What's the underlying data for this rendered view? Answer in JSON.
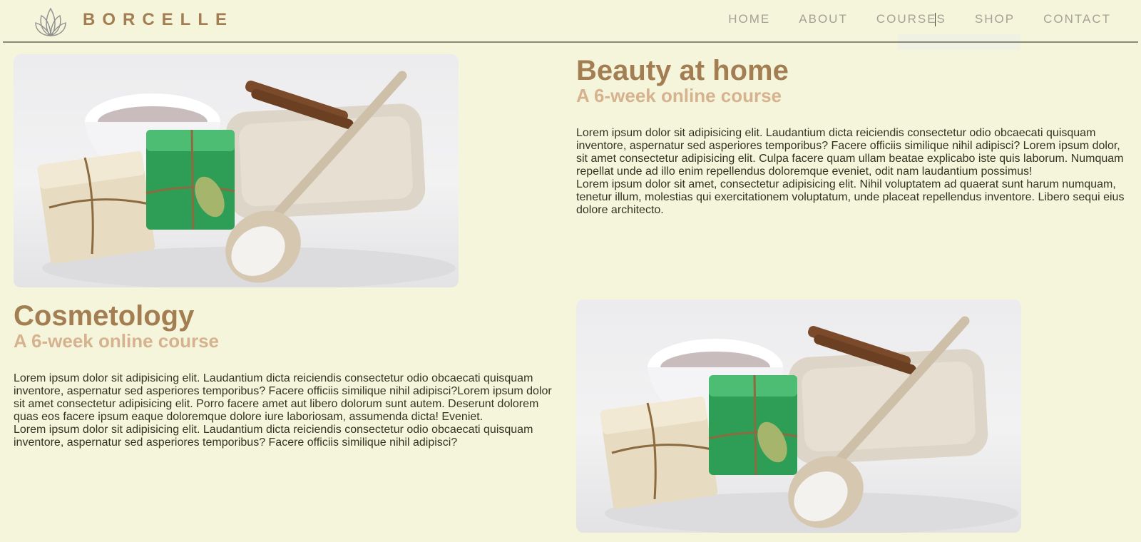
{
  "header": {
    "brand": "BORCELLE",
    "logo_icon": "lotus-icon",
    "nav": [
      {
        "label": "HOME"
      },
      {
        "label": "ABOUT"
      },
      {
        "label": "COURSES"
      },
      {
        "label": "SHOP"
      },
      {
        "label": "CONTACT"
      }
    ]
  },
  "sections": [
    {
      "title": "Beauty at home",
      "subtitle": "A 6-week online course",
      "paragraphs": [
        "Lorem ipsum dolor sit adipisicing elit. Laudantium dicta reiciendis consectetur odio obcaecati quisquam inventore, aspernatur sed asperiores temporibus? Facere officiis similique nihil adipisci? Lorem ipsum dolor, sit amet consectetur adipisicing elit. Culpa facere quam ullam beatae explicabo iste quis laborum. Numquam repellat unde ad illo enim repellendus doloremque eveniet, odit nam laudantium possimus!",
        "Lorem ipsum dolor sit amet, consectetur adipisicing elit. Nihil voluptatem ad quaerat sunt harum numquam, tenetur illum, molestias qui exercitationem voluptatum, unde placeat repellendus inventore. Libero sequi eius dolore architecto."
      ]
    },
    {
      "title": "Cosmetology",
      "subtitle": "A 6-week online course",
      "paragraphs": [
        "Lorem ipsum dolor sit adipisicing elit. Laudantium dicta reiciendis consectetur odio obcaecati quisquam inventore, aspernatur sed asperiores temporibus? Facere officiis similique nihil adipisci?Lorem ipsum dolor sit amet consectetur adipisicing elit. Porro facere amet aut libero dolorum sunt autem. Deserunt dolorem quas eos facere ipsum eaque doloremque dolore iure laboriosam, assumenda dicta! Eveniet.",
        "Lorem ipsum dolor sit adipisicing elit. Laudantium dicta reiciendis consectetur odio obcaecati quisquam inventore, aspernatur sed asperiores temporibus? Facere officiis similique nihil adipisci?"
      ]
    }
  ],
  "colors": {
    "background": "#f5f5dc",
    "brand": "#a37e52",
    "subtitle": "#d6b28f",
    "nav": "#a5a195",
    "body_text": "#333322"
  }
}
